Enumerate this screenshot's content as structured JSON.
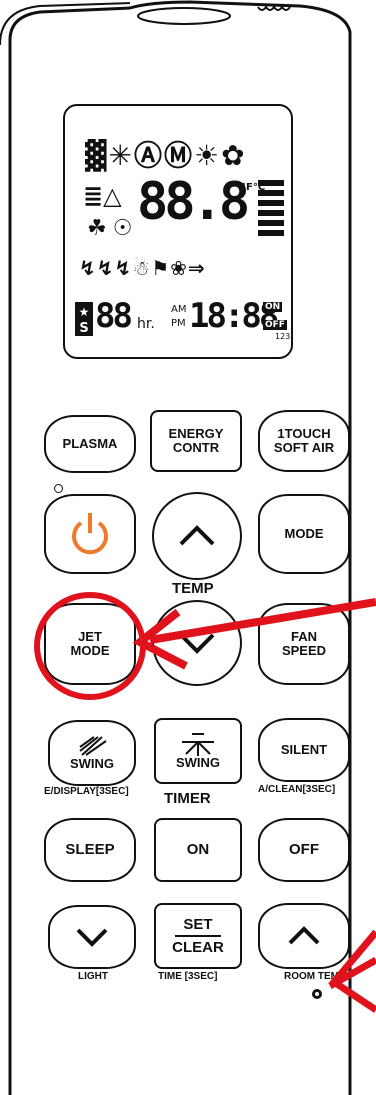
{
  "remote": {
    "display": {
      "icons_row1": "▓✳ⒶⓂ☀✿",
      "icons_row2": "≣△",
      "temp_digits": "88.8",
      "temp_units": "°F°C",
      "icons_row3": "☘☉",
      "icons_row4": "↯↯↯☃⚑❀⇒",
      "hour_digits": "88",
      "hr_label": "hr.",
      "am_label": "AM",
      "pm_label": "PM",
      "clock_digits": "18:88",
      "on_label": "ON",
      "off_label": "OFF",
      "num_label": "123"
    },
    "buttons": {
      "plasma": "PLASMA",
      "energy_contr_1": "ENERGY",
      "energy_contr_2": "CONTR",
      "one_touch_1": "1TOUCH",
      "one_touch_2": "SOFT AIR",
      "mode": "MODE",
      "temp_label": "TEMP",
      "jet_mode_1": "JET",
      "jet_mode_2": "MODE",
      "fan_speed_1": "FAN",
      "fan_speed_2": "SPEED",
      "swing_h": "SWING",
      "swing_v": "SWING",
      "silent": "SILENT",
      "e_display_label": "E/DISPLAY[3SEC]",
      "timer_label": "TIMER",
      "a_clean_label": "A/CLEAN[3SEC]",
      "sleep": "SLEEP",
      "on": "ON",
      "off": "OFF",
      "set": "SET",
      "clear": "CLEAR",
      "light_label": "LIGHT",
      "time_label": "TIME [3SEC]",
      "room_temp_label": "ROOM TEMP"
    },
    "colors": {
      "power_icon": "#f07a2b",
      "highlight": "#e0121c",
      "arrow": "#e0121c"
    }
  }
}
